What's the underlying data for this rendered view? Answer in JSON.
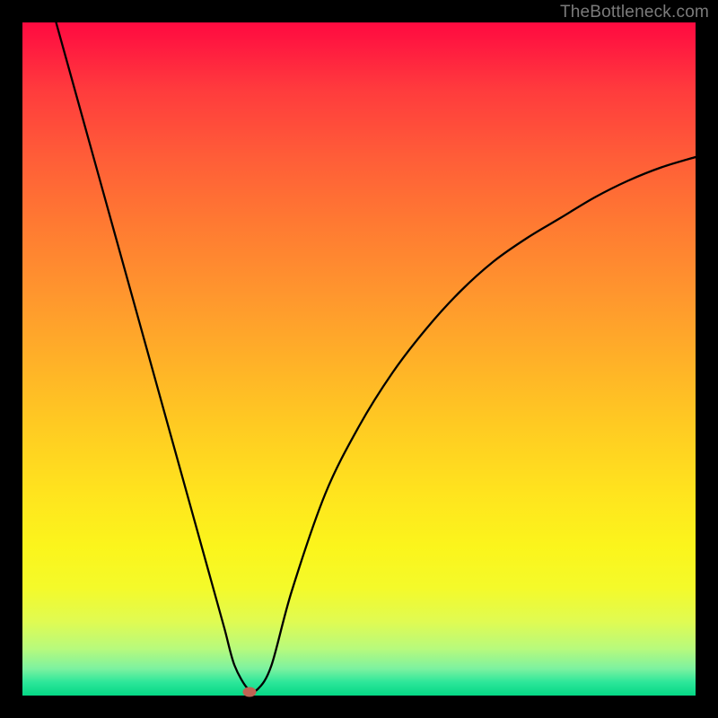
{
  "watermark": "TheBottleneck.com",
  "chart_data": {
    "type": "line",
    "title": "",
    "xlabel": "",
    "ylabel": "",
    "xlim": [
      0,
      100
    ],
    "ylim": [
      0,
      100
    ],
    "x": [
      5,
      10,
      15,
      20,
      25,
      28,
      30,
      31.5,
      33.5,
      35,
      37,
      40,
      45,
      50,
      55,
      60,
      65,
      70,
      75,
      80,
      85,
      90,
      95,
      100
    ],
    "values": [
      100,
      82,
      64,
      46,
      28,
      17.2,
      10,
      4.5,
      1,
      1,
      4.5,
      15.5,
      30,
      40,
      48,
      54.5,
      60,
      64.5,
      68,
      71,
      74,
      76.5,
      78.5,
      80
    ],
    "marker": {
      "x": 33.7,
      "y": 0.5
    },
    "gradient_stops": [
      {
        "pos": 0,
        "color": "#ff0a40"
      },
      {
        "pos": 50,
        "color": "#ffb028"
      },
      {
        "pos": 80,
        "color": "#f7fa22"
      },
      {
        "pos": 100,
        "color": "#05d885"
      }
    ]
  }
}
